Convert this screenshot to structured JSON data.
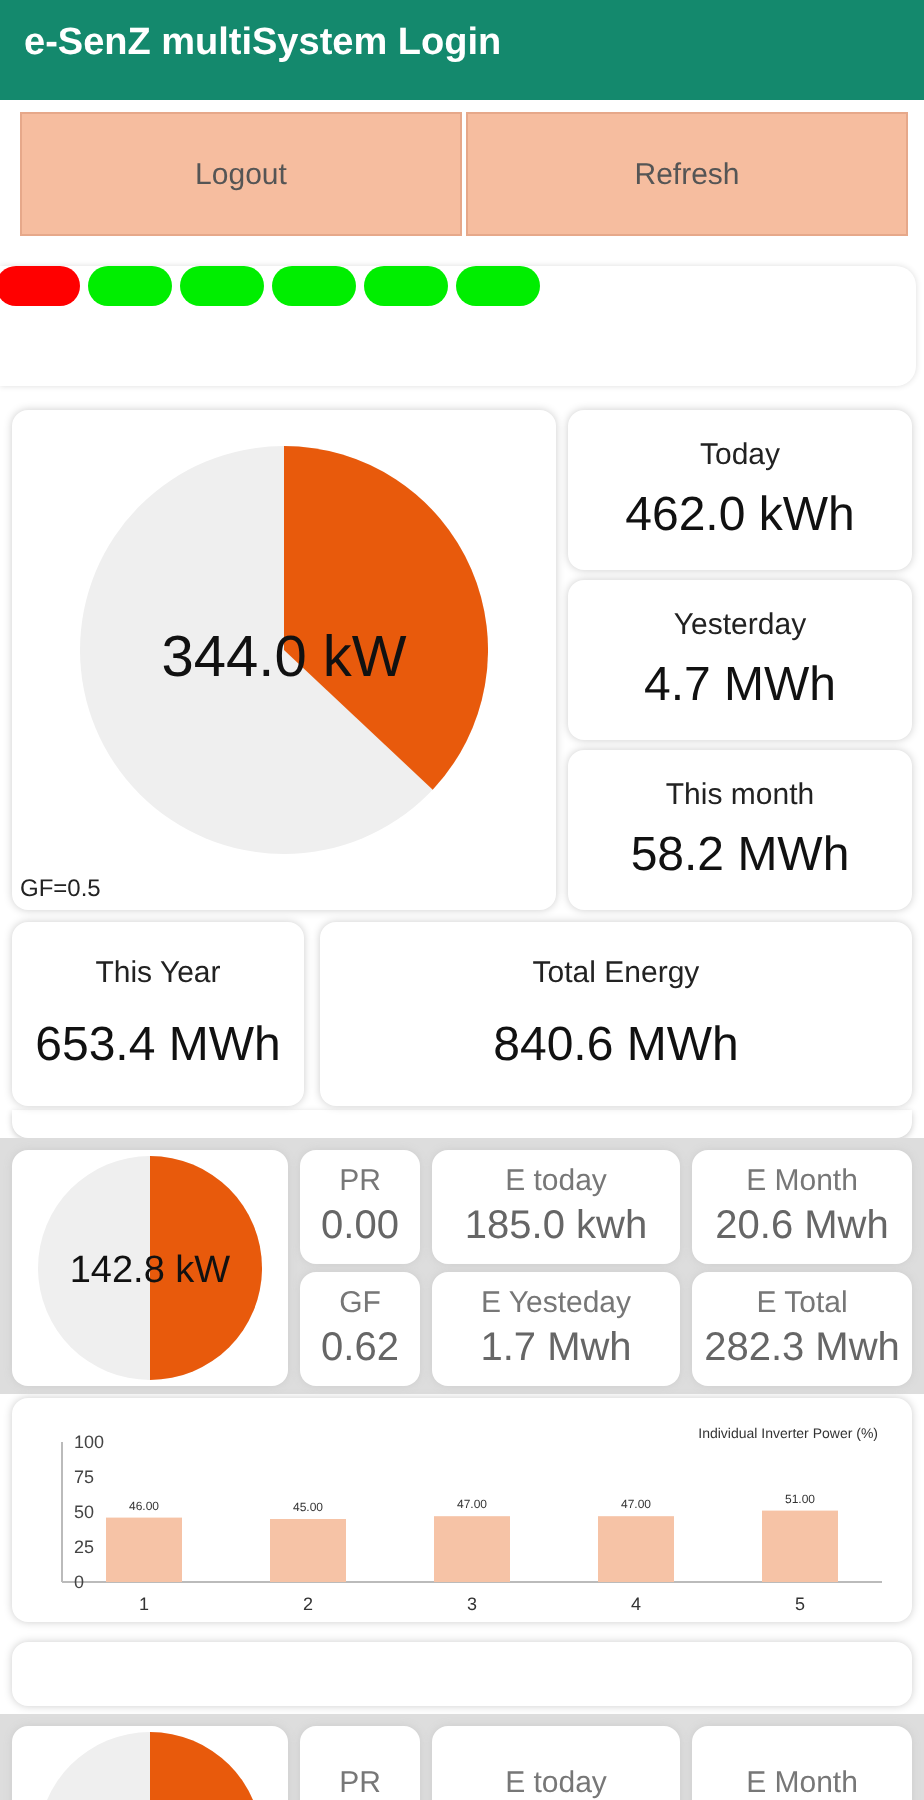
{
  "app_bar": {
    "title": "e-SenZ multiSystem Login"
  },
  "buttons": [
    "Logout",
    "Refresh"
  ],
  "status_pills": [
    {
      "color": "#ff0000"
    },
    {
      "color": "#00ee00"
    },
    {
      "color": "#00ee00"
    },
    {
      "color": "#00ee00"
    },
    {
      "color": "#00ee00"
    },
    {
      "color": "#00ee00"
    }
  ],
  "overview": {
    "power": "344.0 kW",
    "gf": "GF=0.5",
    "side_stats": [
      {
        "label": "Today",
        "value": "462.0 kWh"
      },
      {
        "label": "Yesterday",
        "value": "4.7 MWh"
      },
      {
        "label": "This month",
        "value": "58.2 MWh"
      }
    ],
    "bottom_stats": [
      {
        "label": "This Year",
        "value": "653.4 MWh"
      },
      {
        "label": "Total Energy",
        "value": "840.6 MWh"
      }
    ]
  },
  "plants": [
    {
      "power": "142.8 kW",
      "stats": [
        {
          "label": "PR",
          "value": "0.00"
        },
        {
          "label": "E today",
          "value": "185.0 kwh"
        },
        {
          "label": "E Month",
          "value": "20.6 Mwh"
        },
        {
          "label": "GF",
          "value": "0.62"
        },
        {
          "label": "E Yesteday",
          "value": "1.7 Mwh"
        },
        {
          "label": "E Total",
          "value": "282.3 Mwh"
        }
      ],
      "chart_data": {
        "type": "bar",
        "title": "Individual Inverter Power (%)",
        "categories": [
          "1",
          "2",
          "3",
          "4",
          "5"
        ],
        "values": [
          46,
          45,
          47,
          47,
          51
        ],
        "yticks": [
          0,
          25,
          50,
          75,
          100
        ],
        "ylim": [
          0,
          100
        ],
        "data_labels": true,
        "value_labels": [
          "46.00",
          "45.00",
          "47.00",
          "47.00",
          "51.00"
        ]
      }
    },
    {
      "stats": [
        {
          "label": "PR"
        },
        {
          "label": "E today"
        },
        {
          "label": "E Month"
        }
      ]
    }
  ]
}
